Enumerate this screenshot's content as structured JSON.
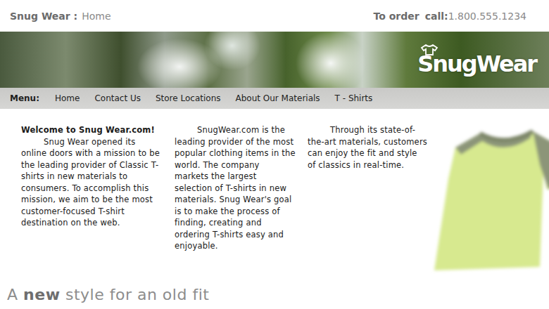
{
  "header": {
    "brand": "Snug Wear :",
    "page": "Home",
    "order_label": "To order",
    "call_label": "call:",
    "phone": "1.800.555.1234"
  },
  "banner": {
    "logo": "SnugWear"
  },
  "menu": {
    "label": "Menu:",
    "items": [
      {
        "label": "Home"
      },
      {
        "label": "Contact Us"
      },
      {
        "label": "Store Locations"
      },
      {
        "label": "About Our Materials"
      },
      {
        "label": "T - Shirts"
      }
    ]
  },
  "columns": [
    {
      "title": "Welcome to Snug Wear.com!",
      "text": "Snug Wear opened its online doors with a mission to be the leading provider of Classic T-shirts in new materials to consumers. To accomplish this mission, we aim to be the most customer-focused T-shirt destination on the web."
    },
    {
      "title": "",
      "text": "SnugWear.com is the leading provider of the most popular clothing items in the world. The company markets the largest selection of T-shirts in new materials. Snug Wear's goal is to make the process of finding, creating and ordering T-shirts easy and enjoyable."
    },
    {
      "title": "",
      "text": "Through its state-of-the-art materials, customers can enjoy the fit and style of classics in real-time."
    }
  ],
  "tagline": [
    {
      "text": "A ",
      "bold": false
    },
    {
      "text": "new",
      "bold": true
    },
    {
      "text": " style for an old fit",
      "bold": false
    }
  ]
}
